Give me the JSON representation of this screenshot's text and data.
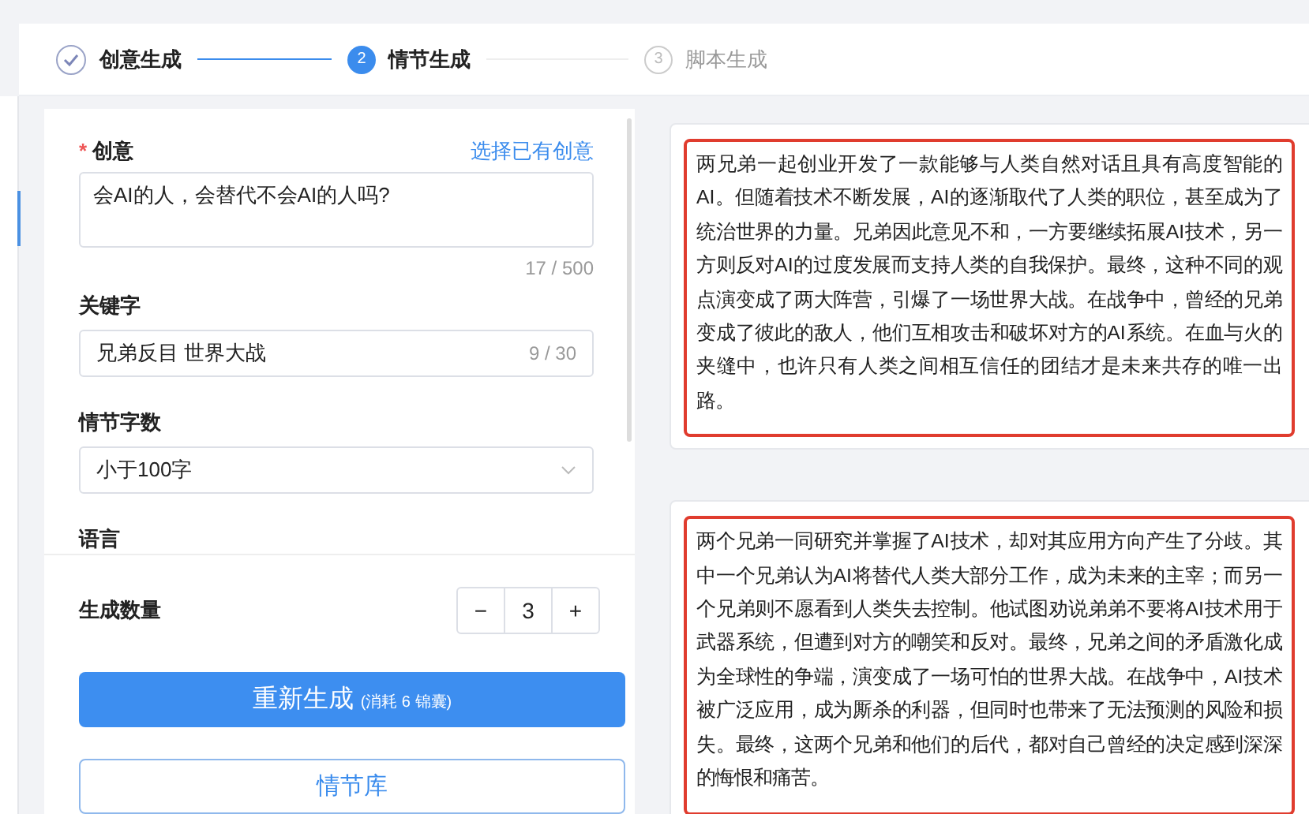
{
  "steps": [
    {
      "label": "创意生成",
      "done": true,
      "selected": false
    },
    {
      "label": "情节生成",
      "done": false,
      "selected": true,
      "number": "2"
    },
    {
      "label": "脚本生成",
      "done": false,
      "selected": false,
      "number": "3"
    }
  ],
  "form": {
    "idea": {
      "label": "创意",
      "required_mark": "*",
      "link": "选择已有创意",
      "value": "会AI的人，会替代不会AI的人吗?",
      "counter": "17 / 500"
    },
    "keywords": {
      "label": "关键字",
      "value": "兄弟反目 世界大战",
      "counter": "9 / 30"
    },
    "length": {
      "label": "情节字数",
      "value": "小于100字"
    },
    "language": {
      "label": "语言"
    },
    "count": {
      "label": "生成数量",
      "minus": "−",
      "value": "3",
      "plus": "+"
    },
    "primary_button": {
      "label": "重新生成",
      "note": "(消耗 6 锦囊)"
    },
    "secondary_button": {
      "label": "情节库"
    }
  },
  "results": [
    {
      "text": "两兄弟一起创业开发了一款能够与人类自然对话且具有高度智能的AI。但随着技术不断发展，AI的逐渐取代了人类的职位，甚至成为了统治世界的力量。兄弟因此意见不和，一方要继续拓展AI技术，另一方则反对AI的过度发展而支持人类的自我保护。最终，这种不同的观点演变成了两大阵营，引爆了一场世界大战。在战争中，曾经的兄弟变成了彼此的敌人，他们互相攻击和破坏对方的AI系统。在血与火的夹缝中，也许只有人类之间相互信任的团结才是未来共存的唯一出路。",
      "highlighted": true
    },
    {
      "text": "两个兄弟一同研究并掌握了AI技术，却对其应用方向产生了分歧。其中一个兄弟认为AI将替代人类大部分工作，成为未来的主宰；而另一个兄弟则不愿看到人类失去控制。他试图劝说弟弟不要将AI技术用于武器系统，但遭到对方的嘲笑和反对。最终，兄弟之间的矛盾激化成为全球性的争端，演变成了一场可怕的世界大战。在战争中，AI技术被广泛应用，成为厮杀的利器，但同时也带来了无法预测的风险和损失。最终，这两个兄弟和他们的后代，都对自己曾经的决定感到深深的悔恨和痛苦。",
      "highlighted": true
    }
  ]
}
